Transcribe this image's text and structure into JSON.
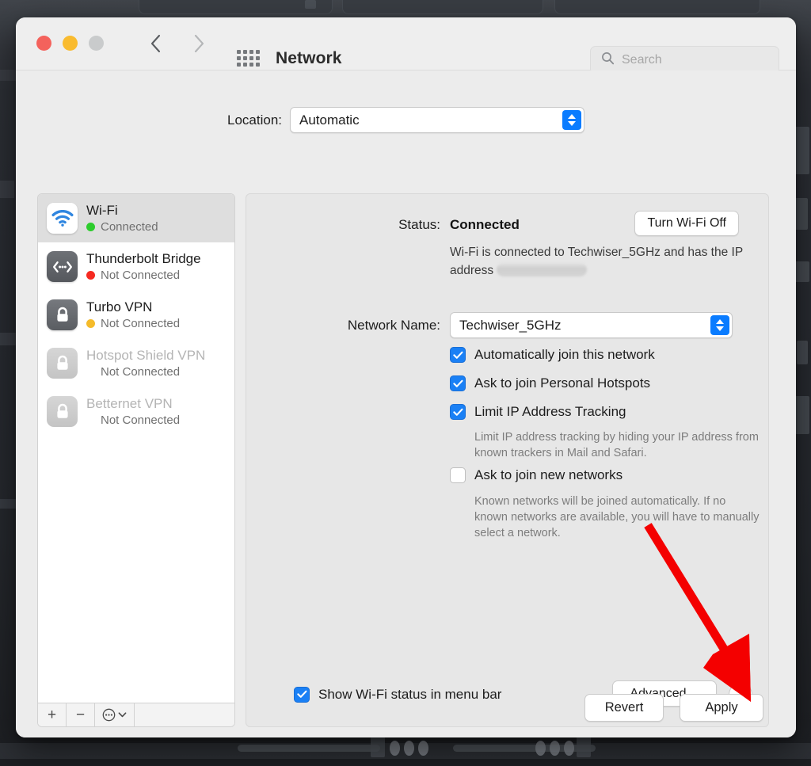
{
  "window": {
    "title": "Network",
    "traffic_lights": [
      "close",
      "minimize",
      "zoom"
    ],
    "colors": {
      "close": "#f4625c",
      "minimize": "#f9bb2f",
      "zoom": "#c9cbcc",
      "accent": "#0a7cff",
      "checkbox_on": "#1a80f5",
      "connected": "#2ccc2c",
      "not_connected": "#f62a21",
      "warning": "#f5bb2a",
      "annotation": "#f40000"
    }
  },
  "toolbar": {
    "back_icon": "chevron-left-icon",
    "forward_icon": "chevron-right-icon",
    "grid_icon": "grid-view-icon",
    "search": {
      "icon": "search-icon",
      "value": "",
      "placeholder": "Search"
    }
  },
  "location": {
    "label": "Location:",
    "value": "Automatic"
  },
  "sidebar": {
    "services": [
      {
        "name": "Wi-Fi",
        "status": "Connected",
        "status_dot": "green",
        "icon": "wifi-icon",
        "selected": true,
        "dimmed": false
      },
      {
        "name": "Thunderbolt Bridge",
        "status": "Not Connected",
        "status_dot": "red",
        "icon": "thunderbolt-bridge-icon",
        "selected": false,
        "dimmed": false
      },
      {
        "name": "Turbo VPN",
        "status": "Not Connected",
        "status_dot": "yellow",
        "icon": "vpn-lock-icon",
        "selected": false,
        "dimmed": false
      },
      {
        "name": "Hotspot Shield VPN",
        "status": "Not Connected",
        "status_dot": "none",
        "icon": "vpn-lock-icon",
        "selected": false,
        "dimmed": true
      },
      {
        "name": "Betternet VPN",
        "status": "Not Connected",
        "status_dot": "none",
        "icon": "vpn-lock-icon",
        "selected": false,
        "dimmed": true
      }
    ],
    "toolbar": {
      "add_label": "+",
      "remove_label": "−",
      "actions_icon": "ellipsis-circle-icon",
      "actions_chevron": "chevron-down-icon"
    }
  },
  "main": {
    "status": {
      "label": "Status:",
      "value": "Connected",
      "toggle_button": "Turn Wi-Fi Off",
      "detail_prefix": "Wi-Fi is connected to Techwiser_5GHz and has the IP address",
      "detail_redacted": true
    },
    "network_name": {
      "label": "Network Name:",
      "value": "Techwiser_5GHz"
    },
    "options": [
      {
        "label": "Automatically join this network",
        "checked": true,
        "help": ""
      },
      {
        "label": "Ask to join Personal Hotspots",
        "checked": true,
        "help": ""
      },
      {
        "label": "Limit IP Address Tracking",
        "checked": true,
        "help": "Limit IP address tracking by hiding your IP address from known trackers in Mail and Safari."
      },
      {
        "label": "Ask to join new networks",
        "checked": false,
        "help": "Known networks will be joined automatically. If no known networks are available, you will have to manually select a network."
      }
    ],
    "show_status_menu_bar": {
      "label": "Show Wi-Fi status in menu bar",
      "checked": true
    },
    "advanced_button": "Advanced…",
    "help_button": "?"
  },
  "footer": {
    "revert_button": "Revert",
    "apply_button": "Apply"
  },
  "annotation": {
    "type": "arrow",
    "points_at": "apply-button",
    "color": "#f40000"
  }
}
